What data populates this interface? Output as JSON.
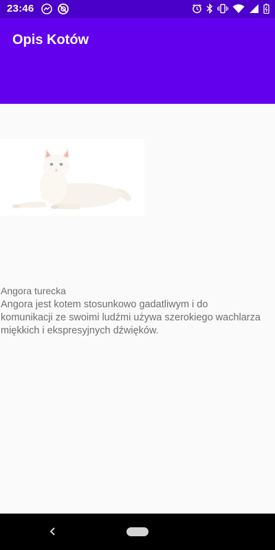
{
  "status_bar": {
    "time": "23:46",
    "left_icons": [
      "messenger-icon",
      "vpn-icon"
    ],
    "right_icons": [
      "alarm-icon",
      "bluetooth-icon",
      "vibrate-icon",
      "wifi-icon",
      "signal-icon",
      "battery-icon"
    ]
  },
  "app_bar": {
    "title": "Opis Kotów"
  },
  "cat": {
    "image": "white-angora-cat-photo",
    "name": "Angora turecka",
    "description": "Angora jest kotem stosunkowo gadatliwym i do komunikacji ze swoimi ludźmi używa szerokiego wachlarza miękkich i ekspresyjnych dźwięków."
  },
  "nav_bar": {
    "buttons": [
      "back-icon",
      "home-icon"
    ]
  },
  "colors": {
    "status_bar": "#4a00c8",
    "app_bar": "#6200ee",
    "background": "#fafafa",
    "text": "#6e6e6e",
    "nav_bar": "#000000"
  }
}
